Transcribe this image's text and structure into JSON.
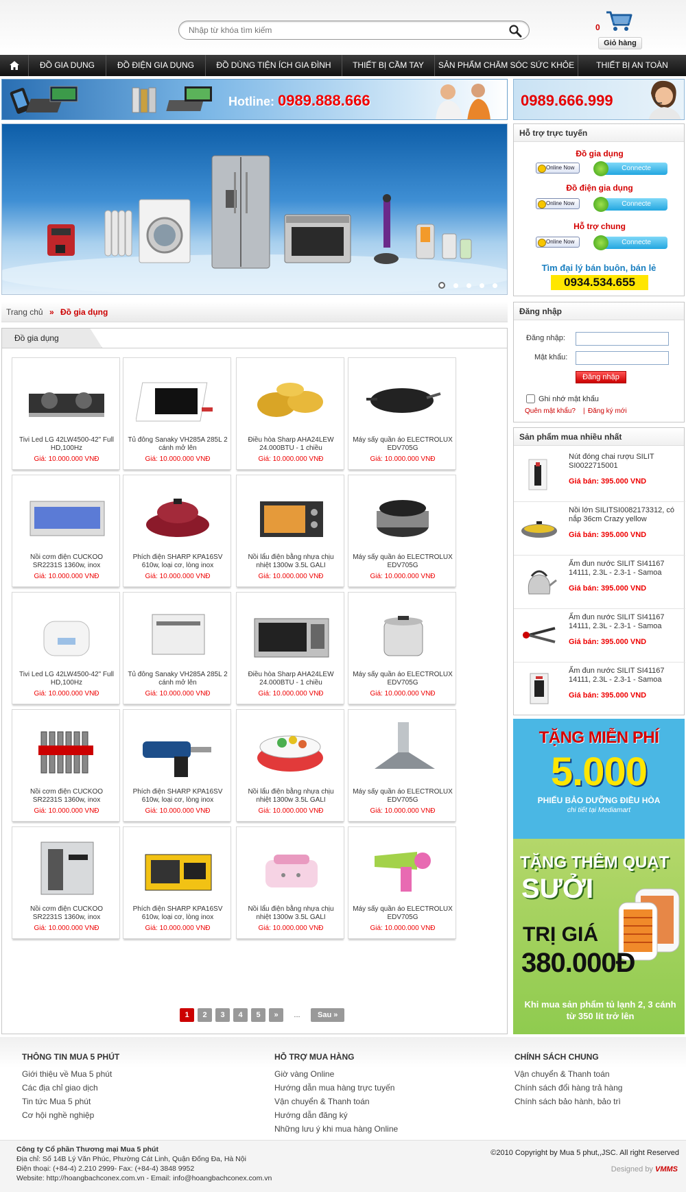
{
  "search": {
    "placeholder": "Nhập từ khóa tìm kiếm"
  },
  "cart": {
    "count": "0",
    "label": "Giỏ hàng"
  },
  "nav": [
    "ĐỒ GIA DỤNG",
    "ĐỒ ĐIỆN GIA DỤNG",
    "ĐỒ DÙNG TIỆN ÍCH GIA ĐÌNH",
    "THIẾT BỊ CẦM TAY",
    "SẢN PHẨM CHĂM SÓC SỨC KHỎE",
    "THIẾT BỊ AN TOÀN"
  ],
  "banner": {
    "hotline_label": "Hotline:",
    "hotline": "0989.888.666",
    "phone2": "0989.666.999"
  },
  "support": {
    "title": "Hỗ trợ trực tuyến",
    "groups": [
      {
        "label": "Đồ gia dụng"
      },
      {
        "label": "Đồ điện gia dụng"
      },
      {
        "label": "Hỗ trợ chung"
      }
    ],
    "online": "Online Now",
    "connect": "Connecte",
    "dealer": "Tìm đại lý bán buôn, bán lẻ",
    "dealer_phone": "0934.534.655"
  },
  "breadcrumb": {
    "home": "Trang chủ",
    "sep": "»",
    "current": "Đồ gia dụng"
  },
  "section_title": "Đồ gia dụng",
  "products": [
    {
      "name": "Tivi Led LG 42LW4500-42\" Full HD,100Hz",
      "price": "Giá: 10.000.000 VNĐ",
      "icon": "gas-stove-icon"
    },
    {
      "name": "Tủ đông Sanaky VH285A 285L 2 cánh mở lên",
      "price": "Giá: 10.000.000 VNĐ",
      "icon": "induction-cooker-icon"
    },
    {
      "name": "Điều hòa Sharp AHA24LEW 24.000BTU - 1 chiều",
      "price": "Giá: 10.000.000 VNĐ",
      "icon": "pot-set-icon"
    },
    {
      "name": "Máy sấy quần áo ELECTROLUX EDV705G",
      "price": "Giá: 10.000.000 VNĐ",
      "icon": "wok-icon"
    },
    {
      "name": "Nồi cơm điện CUCKOO SR2231S 1360w, inox",
      "price": "Giá: 10.000.000 VNĐ",
      "icon": "uv-cabinet-icon"
    },
    {
      "name": "Phích điện SHARP KPA16SV 610w, loại cơ, lòng inox",
      "price": "Giá: 10.000.000 VNĐ",
      "icon": "electric-hotpot-icon"
    },
    {
      "name": "Nồi lẩu điện bằng nhựa chịu nhiệt 1300w 3.5L GALI",
      "price": "Giá: 10.000.000 VNĐ",
      "icon": "toaster-oven-icon"
    },
    {
      "name": "Máy sấy quần áo ELECTROLUX EDV705G",
      "price": "Giá: 10.000.000 VNĐ",
      "icon": "slow-cooker-icon"
    },
    {
      "name": "Tivi Led LG 42LW4500-42\" Full HD,100Hz",
      "price": "Giá: 10.000.000 VNĐ",
      "icon": "rice-cooker-icon"
    },
    {
      "name": "Tủ đông Sanaky VH285A 285L 2 cánh mở lên",
      "price": "Giá: 10.000.000 VNĐ",
      "icon": "dishwasher-icon"
    },
    {
      "name": "Điều hòa Sharp AHA24LEW 24.000BTU - 1 chiều",
      "price": "Giá: 10.000.000 VNĐ",
      "icon": "microwave-icon"
    },
    {
      "name": "Máy sấy quần áo ELECTROLUX EDV705G",
      "price": "Giá: 10.000.000 VNĐ",
      "icon": "warmer-pot-icon"
    },
    {
      "name": "Nồi cơm điện CUCKOO SR2231S 1360w, inox",
      "price": "Giá: 10.000.000 VNĐ",
      "icon": "wrench-set-icon"
    },
    {
      "name": "Phích điện SHARP KPA16SV 610w, loại cơ, lòng inox",
      "price": "Giá: 10.000.000 VNĐ",
      "icon": "power-drill-icon"
    },
    {
      "name": "Nồi lẩu điện bằng nhựa chịu nhiệt 1300w 3.5L GALI",
      "price": "Giá: 10.000.000 VNĐ",
      "icon": "food-container-icon"
    },
    {
      "name": "Máy sấy quần áo ELECTROLUX EDV705G",
      "price": "Giá: 10.000.000 VNĐ",
      "icon": "range-hood-icon"
    },
    {
      "name": "Nồi cơm điện CUCKOO SR2231S 1360w, inox",
      "price": "Giá: 10.000.000 VNĐ",
      "icon": "air-purifier-icon"
    },
    {
      "name": "Phích điện SHARP KPA16SV 610w, loại cơ, lòng inox",
      "price": "Giá: 10.000.000 VNĐ",
      "icon": "generator-icon"
    },
    {
      "name": "Nồi lẩu điện bằng nhựa chịu nhiệt 1300w 3.5L GALI",
      "price": "Giá: 10.000.000 VNĐ",
      "icon": "humidifier-icon"
    },
    {
      "name": "Máy sấy quần áo ELECTROLUX EDV705G",
      "price": "Giá: 10.000.000 VNĐ",
      "icon": "hair-dryer-icon"
    }
  ],
  "pagination": {
    "pages": [
      "1",
      "2",
      "3",
      "4",
      "5"
    ],
    "next_arrow": "»",
    "ellipsis": "...",
    "next": "Sau »",
    "current": "1"
  },
  "login": {
    "title": "Đăng nhập",
    "user_label": "Đăng nhập:",
    "pass_label": "Mật khẩu:",
    "button": "Đăng nhập",
    "remember": "Ghi nhớ mật khẩu",
    "forgot": "Quên mật khẩu?",
    "sep": "|",
    "register": "Đăng ký mới"
  },
  "best": {
    "title": "Sản phẩm mua nhiều nhất",
    "items": [
      {
        "name": "Nút đóng chai rượu SILIT SI0022715001",
        "price": "Giá bán: 395.000 VND"
      },
      {
        "name": "Nồi lớn SILITSI0082173312, có nắp 36cm Crazy yellow",
        "price": "Giá bán: 395.000 VND"
      },
      {
        "name": "Ấm đun nước SILIT SI41167 14111, 2.3L - 2.3-1 - Samoa",
        "price": "Giá bán: 395.000 VND"
      },
      {
        "name": "Ấm đun nước SILIT SI41167 14111, 2.3L - 2.3-1 - Samoa",
        "price": "Giá bán: 395.000 VND"
      },
      {
        "name": "Ấm đun nước SILIT SI41167 14111, 2.3L - 2.3-1 - Samoa",
        "price": "Giá bán: 395.000 VND"
      }
    ]
  },
  "promo": {
    "line1": "TẶNG MIỄN PHÍ",
    "line2": "5.000",
    "line3": "PHIẾU BẢO DƯỠNG ĐIỀU HÒA",
    "line4": "chi tiết tại Mediamart",
    "line5": "TẶNG THÊM QUẠT",
    "line6": "SƯỞI",
    "line7": "TRỊ GIÁ",
    "line8": "380.000Đ",
    "line9": "Khi mua sản phẩm tủ lạnh 2, 3 cánh từ 350 lít trở lên"
  },
  "footer": {
    "cols": [
      {
        "title": "THÔNG TIN MUA 5 PHÚT",
        "links": [
          "Giới thiệu về Mua 5 phút",
          "Các địa chỉ giao dịch",
          "Tin tức Mua 5 phút",
          "Cơ hội nghề nghiệp"
        ]
      },
      {
        "title": "HỖ TRỢ MUA HÀNG",
        "links": [
          "Giờ vàng Online",
          "Hướng dẫn mua hàng trực tuyến",
          "Vận chuyển & Thanh toán",
          "Hướng dẫn đăng ký",
          "Những lưu ý khi mua hàng Online"
        ]
      },
      {
        "title": "CHÍNH SÁCH CHUNG",
        "links": [
          "Vận chuyển & Thanh toán",
          "Chính sách đổi hàng trả hàng",
          "Chính sách bảo hành, bảo trì"
        ]
      }
    ],
    "company": "Công ty Cổ phần Thương mại Mua 5 phút",
    "address": "Địa chỉ: Số 14B Lý Văn Phúc, Phường Cát Linh, Quận Đống Đa, Hà Nội",
    "phone": "Điện thoại: (+84-4) 2.210 2999- Fax: (+84-4) 3848 9952",
    "website": "Website: http://hoangbachconex.com.vn - Email: info@hoangbachconex.com.vn",
    "copyright": "©2010 Copyright by Mua 5 phut,,JSC. All right Reserved",
    "designed": "Designed by",
    "designer": "VMMS"
  }
}
